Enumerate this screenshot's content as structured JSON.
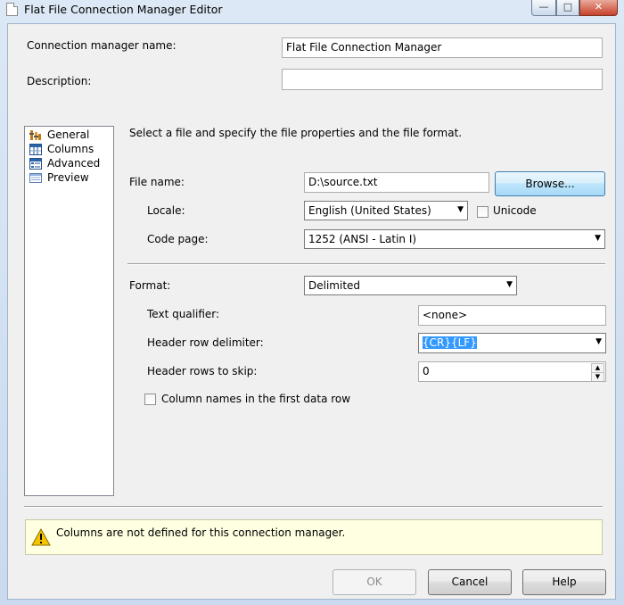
{
  "window": {
    "title": "Flat File Connection Manager Editor",
    "minimize_label": "—",
    "maximize_label": "□",
    "close_label": "✕"
  },
  "connection": {
    "name_label": "Connection manager name:",
    "name_value": "Flat File Connection Manager",
    "description_label": "Description:",
    "description_value": ""
  },
  "nav": {
    "items": [
      {
        "label": "General",
        "icon": "general-icon"
      },
      {
        "label": "Columns",
        "icon": "columns-icon"
      },
      {
        "label": "Advanced",
        "icon": "advanced-icon"
      },
      {
        "label": "Preview",
        "icon": "preview-icon"
      }
    ]
  },
  "general": {
    "instructions": "Select a file and specify the file properties and the file format.",
    "file_name_label": "File name:",
    "file_name_value": "D:\\source.txt",
    "browse_label": "Browse...",
    "locale_label": "Locale:",
    "locale_value": "English (United States)",
    "unicode_label": "Unicode",
    "code_page_label": "Code page:",
    "code_page_value": "1252  (ANSI - Latin I)",
    "format_label": "Format:",
    "format_value": "Delimited",
    "text_qualifier_label": "Text qualifier:",
    "text_qualifier_value": "<none>",
    "header_row_delimiter_label": "Header row delimiter:",
    "header_row_delimiter_value": "{CR}{LF}",
    "header_rows_skip_label": "Header rows to skip:",
    "header_rows_skip_value": "0",
    "column_names_label": "Column names in the first data row"
  },
  "warning": {
    "message": "Columns are not defined for this connection manager."
  },
  "buttons": {
    "ok": "OK",
    "cancel": "Cancel",
    "help": "Help"
  },
  "colors": {
    "selection": "#3399ff",
    "warning_background": "#ffffe1",
    "title_bar": "#dce8f5"
  }
}
